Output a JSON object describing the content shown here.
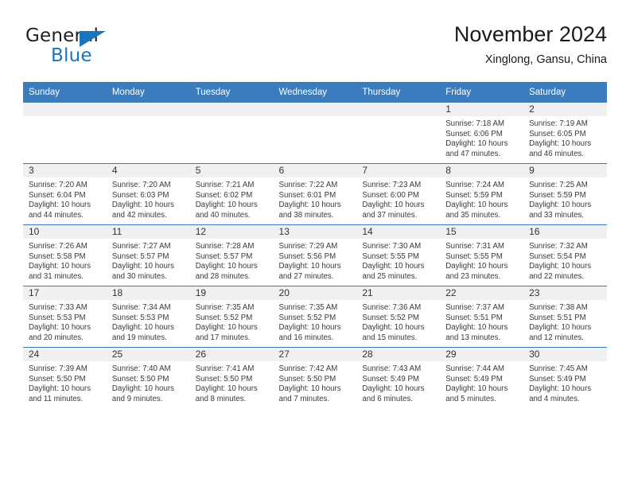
{
  "brand": {
    "name_part1": "General",
    "name_part2": "Blue",
    "triangle_color": "#1b75bb"
  },
  "header": {
    "title": "November 2024",
    "subtitle": "Xinglong, Gansu, China",
    "header_bg": "#3a7cbe"
  },
  "weekdays": [
    "Sunday",
    "Monday",
    "Tuesday",
    "Wednesday",
    "Thursday",
    "Friday",
    "Saturday"
  ],
  "weeks": [
    [
      {
        "day": "",
        "sunrise": "",
        "sunset": "",
        "daylight1": "",
        "daylight2": ""
      },
      {
        "day": "",
        "sunrise": "",
        "sunset": "",
        "daylight1": "",
        "daylight2": ""
      },
      {
        "day": "",
        "sunrise": "",
        "sunset": "",
        "daylight1": "",
        "daylight2": ""
      },
      {
        "day": "",
        "sunrise": "",
        "sunset": "",
        "daylight1": "",
        "daylight2": ""
      },
      {
        "day": "",
        "sunrise": "",
        "sunset": "",
        "daylight1": "",
        "daylight2": ""
      },
      {
        "day": "1",
        "sunrise": "Sunrise: 7:18 AM",
        "sunset": "Sunset: 6:06 PM",
        "daylight1": "Daylight: 10 hours",
        "daylight2": "and 47 minutes."
      },
      {
        "day": "2",
        "sunrise": "Sunrise: 7:19 AM",
        "sunset": "Sunset: 6:05 PM",
        "daylight1": "Daylight: 10 hours",
        "daylight2": "and 46 minutes."
      }
    ],
    [
      {
        "day": "3",
        "sunrise": "Sunrise: 7:20 AM",
        "sunset": "Sunset: 6:04 PM",
        "daylight1": "Daylight: 10 hours",
        "daylight2": "and 44 minutes."
      },
      {
        "day": "4",
        "sunrise": "Sunrise: 7:20 AM",
        "sunset": "Sunset: 6:03 PM",
        "daylight1": "Daylight: 10 hours",
        "daylight2": "and 42 minutes."
      },
      {
        "day": "5",
        "sunrise": "Sunrise: 7:21 AM",
        "sunset": "Sunset: 6:02 PM",
        "daylight1": "Daylight: 10 hours",
        "daylight2": "and 40 minutes."
      },
      {
        "day": "6",
        "sunrise": "Sunrise: 7:22 AM",
        "sunset": "Sunset: 6:01 PM",
        "daylight1": "Daylight: 10 hours",
        "daylight2": "and 38 minutes."
      },
      {
        "day": "7",
        "sunrise": "Sunrise: 7:23 AM",
        "sunset": "Sunset: 6:00 PM",
        "daylight1": "Daylight: 10 hours",
        "daylight2": "and 37 minutes."
      },
      {
        "day": "8",
        "sunrise": "Sunrise: 7:24 AM",
        "sunset": "Sunset: 5:59 PM",
        "daylight1": "Daylight: 10 hours",
        "daylight2": "and 35 minutes."
      },
      {
        "day": "9",
        "sunrise": "Sunrise: 7:25 AM",
        "sunset": "Sunset: 5:59 PM",
        "daylight1": "Daylight: 10 hours",
        "daylight2": "and 33 minutes."
      }
    ],
    [
      {
        "day": "10",
        "sunrise": "Sunrise: 7:26 AM",
        "sunset": "Sunset: 5:58 PM",
        "daylight1": "Daylight: 10 hours",
        "daylight2": "and 31 minutes."
      },
      {
        "day": "11",
        "sunrise": "Sunrise: 7:27 AM",
        "sunset": "Sunset: 5:57 PM",
        "daylight1": "Daylight: 10 hours",
        "daylight2": "and 30 minutes."
      },
      {
        "day": "12",
        "sunrise": "Sunrise: 7:28 AM",
        "sunset": "Sunset: 5:57 PM",
        "daylight1": "Daylight: 10 hours",
        "daylight2": "and 28 minutes."
      },
      {
        "day": "13",
        "sunrise": "Sunrise: 7:29 AM",
        "sunset": "Sunset: 5:56 PM",
        "daylight1": "Daylight: 10 hours",
        "daylight2": "and 27 minutes."
      },
      {
        "day": "14",
        "sunrise": "Sunrise: 7:30 AM",
        "sunset": "Sunset: 5:55 PM",
        "daylight1": "Daylight: 10 hours",
        "daylight2": "and 25 minutes."
      },
      {
        "day": "15",
        "sunrise": "Sunrise: 7:31 AM",
        "sunset": "Sunset: 5:55 PM",
        "daylight1": "Daylight: 10 hours",
        "daylight2": "and 23 minutes."
      },
      {
        "day": "16",
        "sunrise": "Sunrise: 7:32 AM",
        "sunset": "Sunset: 5:54 PM",
        "daylight1": "Daylight: 10 hours",
        "daylight2": "and 22 minutes."
      }
    ],
    [
      {
        "day": "17",
        "sunrise": "Sunrise: 7:33 AM",
        "sunset": "Sunset: 5:53 PM",
        "daylight1": "Daylight: 10 hours",
        "daylight2": "and 20 minutes."
      },
      {
        "day": "18",
        "sunrise": "Sunrise: 7:34 AM",
        "sunset": "Sunset: 5:53 PM",
        "daylight1": "Daylight: 10 hours",
        "daylight2": "and 19 minutes."
      },
      {
        "day": "19",
        "sunrise": "Sunrise: 7:35 AM",
        "sunset": "Sunset: 5:52 PM",
        "daylight1": "Daylight: 10 hours",
        "daylight2": "and 17 minutes."
      },
      {
        "day": "20",
        "sunrise": "Sunrise: 7:35 AM",
        "sunset": "Sunset: 5:52 PM",
        "daylight1": "Daylight: 10 hours",
        "daylight2": "and 16 minutes."
      },
      {
        "day": "21",
        "sunrise": "Sunrise: 7:36 AM",
        "sunset": "Sunset: 5:52 PM",
        "daylight1": "Daylight: 10 hours",
        "daylight2": "and 15 minutes."
      },
      {
        "day": "22",
        "sunrise": "Sunrise: 7:37 AM",
        "sunset": "Sunset: 5:51 PM",
        "daylight1": "Daylight: 10 hours",
        "daylight2": "and 13 minutes."
      },
      {
        "day": "23",
        "sunrise": "Sunrise: 7:38 AM",
        "sunset": "Sunset: 5:51 PM",
        "daylight1": "Daylight: 10 hours",
        "daylight2": "and 12 minutes."
      }
    ],
    [
      {
        "day": "24",
        "sunrise": "Sunrise: 7:39 AM",
        "sunset": "Sunset: 5:50 PM",
        "daylight1": "Daylight: 10 hours",
        "daylight2": "and 11 minutes."
      },
      {
        "day": "25",
        "sunrise": "Sunrise: 7:40 AM",
        "sunset": "Sunset: 5:50 PM",
        "daylight1": "Daylight: 10 hours",
        "daylight2": "and 9 minutes."
      },
      {
        "day": "26",
        "sunrise": "Sunrise: 7:41 AM",
        "sunset": "Sunset: 5:50 PM",
        "daylight1": "Daylight: 10 hours",
        "daylight2": "and 8 minutes."
      },
      {
        "day": "27",
        "sunrise": "Sunrise: 7:42 AM",
        "sunset": "Sunset: 5:50 PM",
        "daylight1": "Daylight: 10 hours",
        "daylight2": "and 7 minutes."
      },
      {
        "day": "28",
        "sunrise": "Sunrise: 7:43 AM",
        "sunset": "Sunset: 5:49 PM",
        "daylight1": "Daylight: 10 hours",
        "daylight2": "and 6 minutes."
      },
      {
        "day": "29",
        "sunrise": "Sunrise: 7:44 AM",
        "sunset": "Sunset: 5:49 PM",
        "daylight1": "Daylight: 10 hours",
        "daylight2": "and 5 minutes."
      },
      {
        "day": "30",
        "sunrise": "Sunrise: 7:45 AM",
        "sunset": "Sunset: 5:49 PM",
        "daylight1": "Daylight: 10 hours",
        "daylight2": "and 4 minutes."
      }
    ]
  ]
}
